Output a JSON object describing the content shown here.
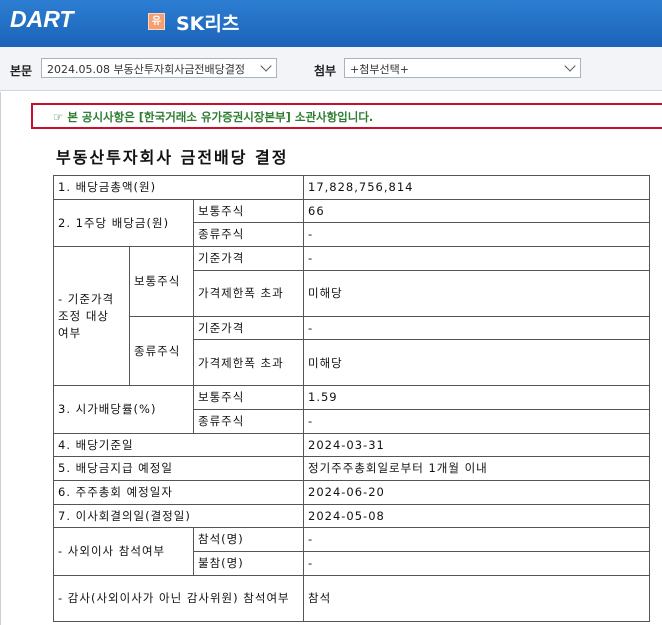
{
  "header": {
    "logo": "DART",
    "badge": "유",
    "company": "SK리츠"
  },
  "toolbar": {
    "main_label": "본문",
    "main_value": "2024.05.08  부동산투자회사금전배당결정",
    "attach_label": "첨부",
    "attach_value": "+첨부선택+"
  },
  "notice": "☞ 본 공시사항은 [한국거래소 유가증권시장본부] 소관사항입니다.",
  "doc_title": "부동산투자회사 금전배당 결정",
  "table": {
    "r1_label": "1. 배당금총액(원)",
    "r1_value": "17,828,756,814",
    "r2_label": "2. 1주당 배당금(원)",
    "r2_common": "보통주식",
    "r2_common_value": "66",
    "r2_pref": "종류주식",
    "r2_pref_value": "-",
    "r3_label": "- 기준가격 조정 대상 여부",
    "r3_common": "보통주식",
    "r3_pref": "종류주식",
    "base_price": "기준가격",
    "base_price_common_value": "-",
    "limit_exceed": "가격제한폭 초과",
    "limit_common_value": "미해당",
    "base_price_pref_value": "-",
    "limit_pref_value": "미해당",
    "r4_label": "3. 시가배당률(%)",
    "r4_common": "보통주식",
    "r4_common_value": "1.59",
    "r4_pref": "종류주식",
    "r4_pref_value": "-",
    "r5_label": "4. 배당기준일",
    "r5_value": "2024-03-31",
    "r6_label": "5. 배당금지급 예정일",
    "r6_value": "정기주주총회일로부터 1개월 이내",
    "r7_label": "6. 주주총회 예정일자",
    "r7_value": "2024-06-20",
    "r8_label": "7. 이사회결의일(결정일)",
    "r8_value": "2024-05-08",
    "r9_label": "- 사외이사 참석여부",
    "r9_attend": "참석(명)",
    "r9_attend_value": "-",
    "r9_absent": "불참(명)",
    "r9_absent_value": "-",
    "r10_label": "- 감사(사외이사가 아닌 감사위원) 참석여부",
    "r10_value": "참석"
  }
}
